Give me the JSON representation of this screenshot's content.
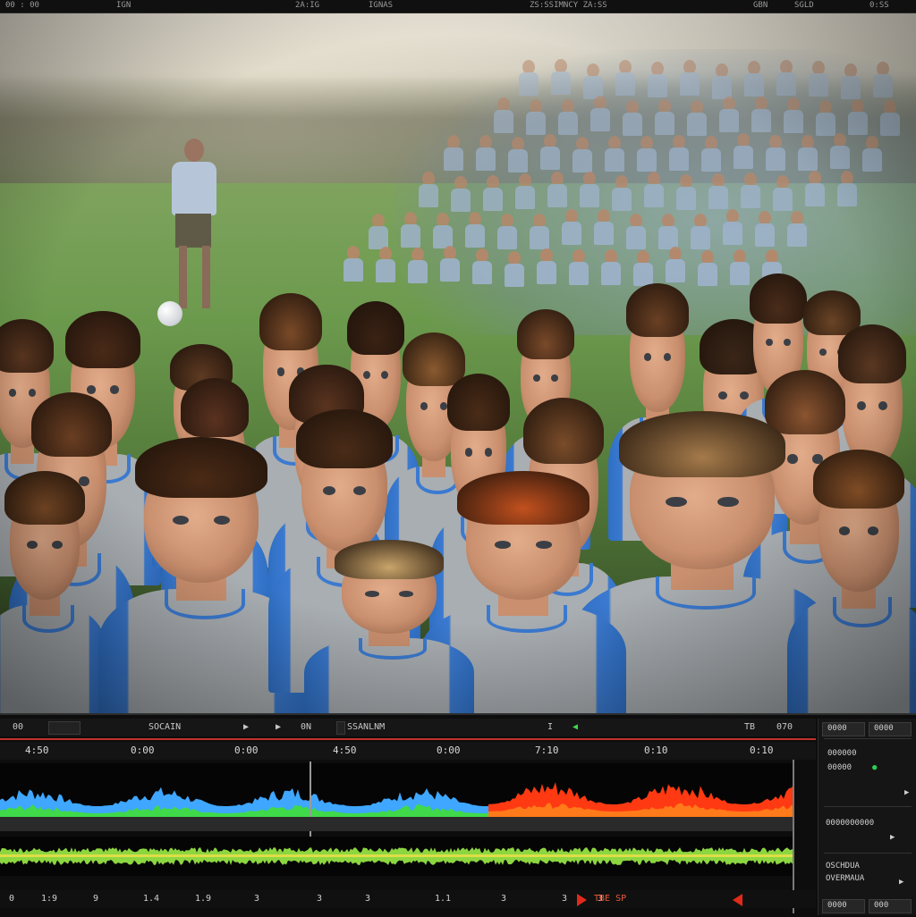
{
  "topbar": {
    "items": [
      "00 : 00",
      "IGN",
      "2A:IG",
      "IGNAS",
      "ZS:SSIMNCY ZA:SS",
      "GBN",
      "SGLD",
      "0:SS"
    ]
  },
  "viewer": {
    "alt": "Video frame: a large group of boys in grey and blue soccer jerseys on a misty field"
  },
  "ctrl": {
    "tc_left": "00",
    "label_mode": "SOCAIN",
    "play": "▶",
    "next": "▶",
    "tc_b": "0N",
    "file": "SSANLNM",
    "mark": "I",
    "back": "◀",
    "tc_right_a": "TB",
    "tc_right_b": "070"
  },
  "ruler": {
    "labels": [
      "4:50",
      "0:00",
      "0:00",
      "4:50",
      "0:00",
      "7:10",
      "0:10",
      "0:10"
    ]
  },
  "bottom_ruler": {
    "labels": [
      "0",
      "1:9",
      "9",
      "1.4",
      "1.9",
      "3",
      "3",
      "3",
      "1.1",
      "3",
      "3",
      "3",
      "TBE SP"
    ]
  },
  "right_panel": {
    "btn_a": "0000",
    "btn_b": "0000",
    "row1": "000000",
    "row2": "00000",
    "row3": "0000000000",
    "row4": "OSCHDUA",
    "row5": "OVERMAUA",
    "row6": "0000",
    "row7": "000"
  },
  "colors": {
    "wave_blue": "#3fa7ff",
    "wave_green": "#3fd94a",
    "wave_red": "#ff3a12",
    "wave_orange": "#ff7a1a",
    "audio_green": "#8cd640",
    "audio_yellow": "#f2e04a",
    "playhead": "#c0322a"
  }
}
